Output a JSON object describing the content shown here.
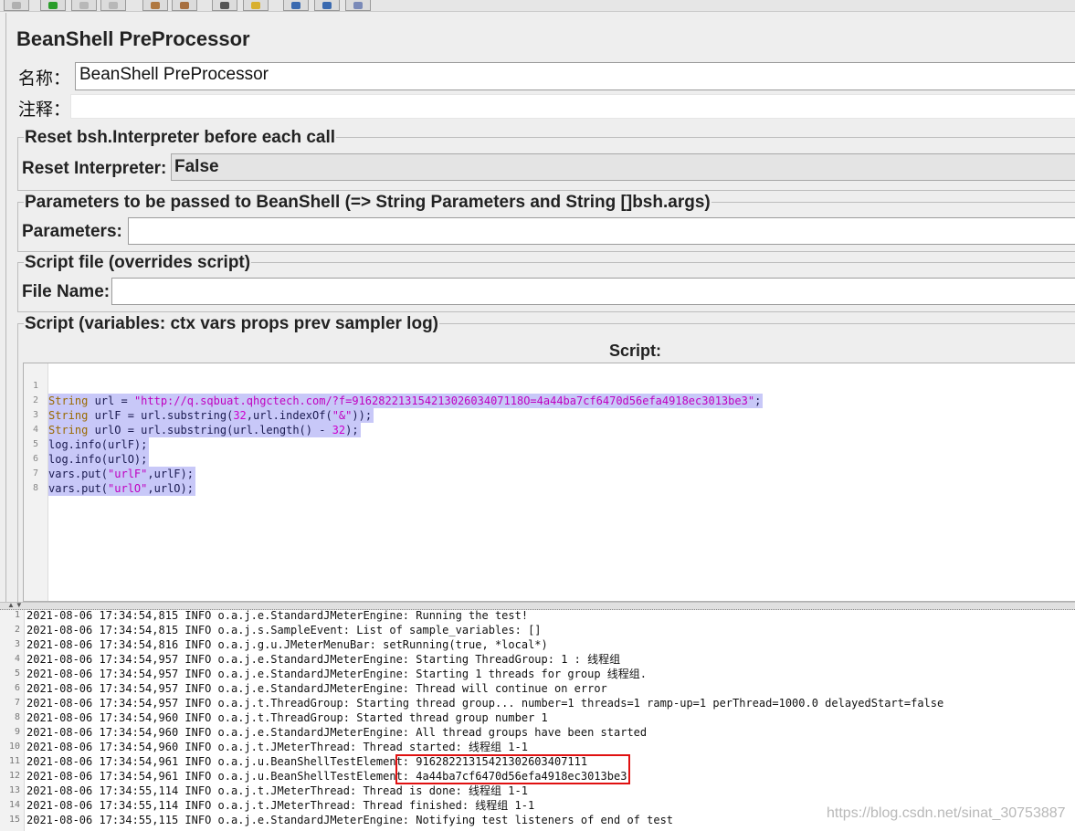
{
  "panel": {
    "title": "BeanShell PreProcessor"
  },
  "name_row": {
    "label": "名称：",
    "value": "BeanShell PreProcessor"
  },
  "comment_row": {
    "label": "注释：",
    "value": ""
  },
  "reset_group": {
    "title": "Reset bsh.Interpreter before each call",
    "field_label": "Reset Interpreter:",
    "value": "False"
  },
  "params_group": {
    "title": "Parameters to be passed to BeanShell (=> String Parameters and String []bsh.args)",
    "field_label": "Parameters:",
    "value": ""
  },
  "file_group": {
    "title": "Script file (overrides script)",
    "field_label": "File Name:",
    "value": ""
  },
  "script_group": {
    "title": "Script (variables: ctx vars props prev sampler log)",
    "caption": "Script:",
    "lines": [
      "String url = \"http://q.sqbuat.qhgctech.com/?f=91628221315421302603407118O=4a44ba7cf6470d56efa4918ec3013be3\";",
      "String urlF = url.substring(32,url.indexOf(\"&\"));",
      "String urlO = url.substring(url.length() - 32);",
      "log.info(urlF);",
      "log.info(urlO);",
      "vars.put(\"urlF\",urlF);",
      "vars.put(\"urlO\",urlO);",
      ""
    ]
  },
  "splitter": {
    "arrows": "▲▼"
  },
  "log": {
    "lines": [
      "2021-08-06 17:34:54,815 INFO o.a.j.e.StandardJMeterEngine: Running the test!",
      "2021-08-06 17:34:54,815 INFO o.a.j.s.SampleEvent: List of sample_variables: []",
      "2021-08-06 17:34:54,816 INFO o.a.j.g.u.JMeterMenuBar: setRunning(true, *local*)",
      "2021-08-06 17:34:54,957 INFO o.a.j.e.StandardJMeterEngine: Starting ThreadGroup: 1 : 线程组",
      "2021-08-06 17:34:54,957 INFO o.a.j.e.StandardJMeterEngine: Starting 1 threads for group 线程组.",
      "2021-08-06 17:34:54,957 INFO o.a.j.e.StandardJMeterEngine: Thread will continue on error",
      "2021-08-06 17:34:54,957 INFO o.a.j.t.ThreadGroup: Starting thread group... number=1 threads=1 ramp-up=1 perThread=1000.0 delayedStart=false",
      "2021-08-06 17:34:54,960 INFO o.a.j.t.ThreadGroup: Started thread group number 1",
      "2021-08-06 17:34:54,960 INFO o.a.j.e.StandardJMeterEngine: All thread groups have been started",
      "2021-08-06 17:34:54,960 INFO o.a.j.t.JMeterThread: Thread started: 线程组 1-1",
      "2021-08-06 17:34:54,961 INFO o.a.j.u.BeanShellTestElement: 91628221315421302603407111",
      "2021-08-06 17:34:54,961 INFO o.a.j.u.BeanShellTestElement: 4a44ba7cf6470d56efa4918ec3013be3",
      "2021-08-06 17:34:55,114 INFO o.a.j.t.JMeterThread: Thread is done: 线程组 1-1",
      "2021-08-06 17:34:55,114 INFO o.a.j.t.JMeterThread: Thread finished: 线程组 1-1",
      "2021-08-06 17:34:55,115 INFO o.a.j.e.StandardJMeterEngine: Notifying test listeners of end of test"
    ]
  },
  "watermark": "https://blog.csdn.net/sinat_30753887",
  "colors": {
    "highlight": "#e01010",
    "code_selection": "#c8c8f8"
  }
}
